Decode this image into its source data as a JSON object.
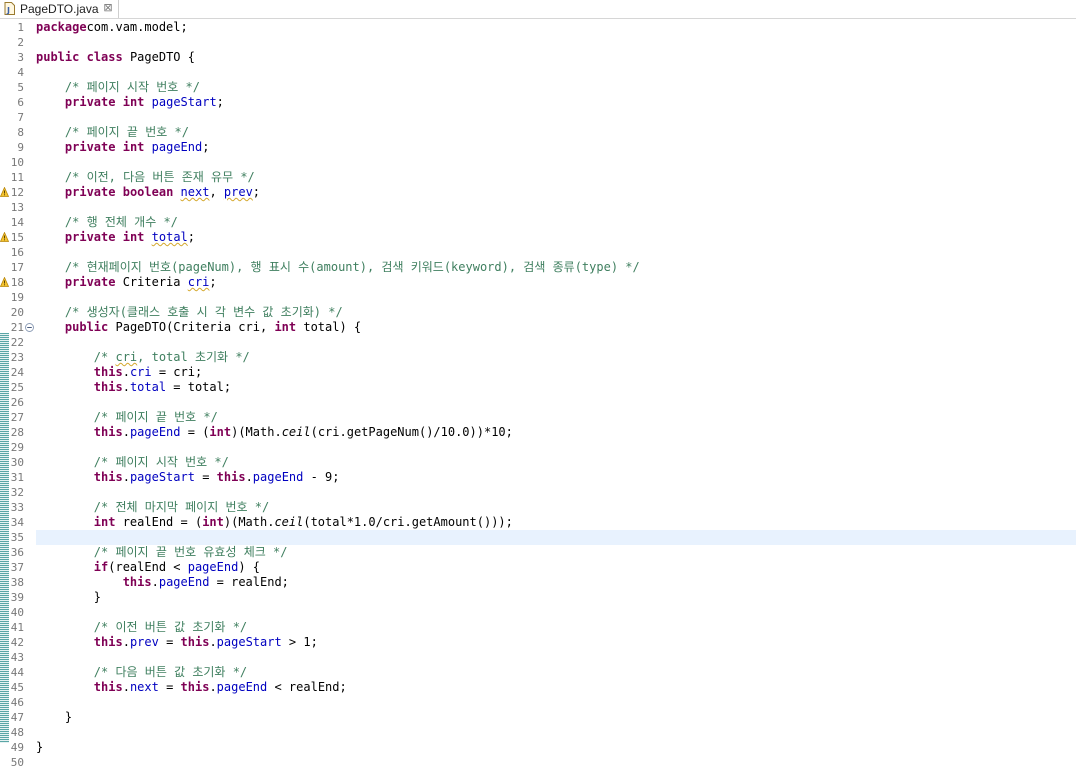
{
  "tab": {
    "file_icon": "java-file-icon",
    "label": "PageDTO.java",
    "close_icon": "close-icon",
    "close_glyph": "⊠"
  },
  "editor": {
    "current_line": 35,
    "lines": [
      {
        "n": "1",
        "t": [
          [
            "kw",
            "package"
          ],
          [
            "",
            "com.vam.model;"
          ]
        ]
      },
      {
        "n": "2",
        "t": []
      },
      {
        "n": "3",
        "t": [
          [
            "kw",
            "public"
          ],
          [
            "",
            " "
          ],
          [
            "kw",
            "class"
          ],
          [
            "",
            " PageDTO {"
          ]
        ]
      },
      {
        "n": "4",
        "t": []
      },
      {
        "n": "5",
        "t": [
          [
            "",
            "    "
          ],
          [
            "cm",
            "/* 페이지 시작 번호 */"
          ]
        ]
      },
      {
        "n": "6",
        "t": [
          [
            "",
            "    "
          ],
          [
            "kw",
            "private"
          ],
          [
            "",
            " "
          ],
          [
            "kw",
            "int"
          ],
          [
            "",
            " "
          ],
          [
            "fd",
            "pageStart"
          ],
          [
            "",
            ";"
          ]
        ]
      },
      {
        "n": "7",
        "t": []
      },
      {
        "n": "8",
        "t": [
          [
            "",
            "    "
          ],
          [
            "cm",
            "/* 페이지 끝 번호 */"
          ]
        ]
      },
      {
        "n": "9",
        "t": [
          [
            "",
            "    "
          ],
          [
            "kw",
            "private"
          ],
          [
            "",
            " "
          ],
          [
            "kw",
            "int"
          ],
          [
            "",
            " "
          ],
          [
            "fd",
            "pageEnd"
          ],
          [
            "",
            ";"
          ]
        ]
      },
      {
        "n": "10",
        "t": []
      },
      {
        "n": "11",
        "t": [
          [
            "",
            "    "
          ],
          [
            "cm",
            "/* 이전, 다음 버튼 존재 유무 */"
          ]
        ]
      },
      {
        "n": "12",
        "w": true,
        "t": [
          [
            "",
            "    "
          ],
          [
            "kw",
            "private"
          ],
          [
            "",
            " "
          ],
          [
            "kw",
            "boolean"
          ],
          [
            "",
            " "
          ],
          [
            "fd wv",
            "next"
          ],
          [
            "",
            ", "
          ],
          [
            "fd wv",
            "prev"
          ],
          [
            "",
            ";"
          ]
        ]
      },
      {
        "n": "13",
        "t": []
      },
      {
        "n": "14",
        "t": [
          [
            "",
            "    "
          ],
          [
            "cm",
            "/* 행 전체 개수 */"
          ]
        ]
      },
      {
        "n": "15",
        "w": true,
        "t": [
          [
            "",
            "    "
          ],
          [
            "kw",
            "private"
          ],
          [
            "",
            " "
          ],
          [
            "kw",
            "int"
          ],
          [
            "",
            " "
          ],
          [
            "fd wv",
            "total"
          ],
          [
            "",
            ";"
          ]
        ]
      },
      {
        "n": "16",
        "t": []
      },
      {
        "n": "17",
        "t": [
          [
            "",
            "    "
          ],
          [
            "cm",
            "/* 현재페이지 번호(pageNum), 행 표시 수(amount), 검색 키워드(keyword), 검색 종류(type) */"
          ]
        ]
      },
      {
        "n": "18",
        "w": true,
        "t": [
          [
            "",
            "    "
          ],
          [
            "kw",
            "private"
          ],
          [
            "",
            " Criteria "
          ],
          [
            "fd wv",
            "cri"
          ],
          [
            "",
            ";"
          ]
        ]
      },
      {
        "n": "19",
        "t": []
      },
      {
        "n": "20",
        "t": [
          [
            "",
            "    "
          ],
          [
            "cm",
            "/* 생성자(클래스 호출 시 각 변수 값 초기화) */"
          ]
        ]
      },
      {
        "n": "21",
        "f": true,
        "t": [
          [
            "",
            "    "
          ],
          [
            "kw",
            "public"
          ],
          [
            "",
            " PageDTO(Criteria cri, "
          ],
          [
            "kw",
            "int"
          ],
          [
            "",
            " total) {"
          ]
        ]
      },
      {
        "n": "22",
        "t": []
      },
      {
        "n": "23",
        "t": [
          [
            "",
            "        "
          ],
          [
            "cm",
            "/* "
          ],
          [
            "cm wv",
            "cri"
          ],
          [
            "cm",
            ", total 초기화 */"
          ]
        ]
      },
      {
        "n": "24",
        "t": [
          [
            "",
            "        "
          ],
          [
            "kw",
            "this"
          ],
          [
            "",
            "."
          ],
          [
            "fd",
            "cri"
          ],
          [
            "",
            " = cri;"
          ]
        ]
      },
      {
        "n": "25",
        "t": [
          [
            "",
            "        "
          ],
          [
            "kw",
            "this"
          ],
          [
            "",
            "."
          ],
          [
            "fd",
            "total"
          ],
          [
            "",
            " = total;"
          ]
        ]
      },
      {
        "n": "26",
        "t": []
      },
      {
        "n": "27",
        "t": [
          [
            "",
            "        "
          ],
          [
            "cm",
            "/* 페이지 끝 번호 */"
          ]
        ]
      },
      {
        "n": "28",
        "t": [
          [
            "",
            "        "
          ],
          [
            "kw",
            "this"
          ],
          [
            "",
            "."
          ],
          [
            "fd",
            "pageEnd"
          ],
          [
            "",
            " = ("
          ],
          [
            "kw",
            "int"
          ],
          [
            "",
            ")(Math."
          ],
          [
            "st",
            "ceil"
          ],
          [
            "",
            "(cri.getPageNum()/10.0))*10;"
          ]
        ]
      },
      {
        "n": "29",
        "t": []
      },
      {
        "n": "30",
        "t": [
          [
            "",
            "        "
          ],
          [
            "cm",
            "/* 페이지 시작 번호 */"
          ]
        ]
      },
      {
        "n": "31",
        "t": [
          [
            "",
            "        "
          ],
          [
            "kw",
            "this"
          ],
          [
            "",
            "."
          ],
          [
            "fd",
            "pageStart"
          ],
          [
            "",
            " = "
          ],
          [
            "kw",
            "this"
          ],
          [
            "",
            "."
          ],
          [
            "fd",
            "pageEnd"
          ],
          [
            "",
            " - 9;"
          ]
        ]
      },
      {
        "n": "32",
        "t": []
      },
      {
        "n": "33",
        "t": [
          [
            "",
            "        "
          ],
          [
            "cm",
            "/* 전체 마지막 페이지 번호 */"
          ]
        ]
      },
      {
        "n": "34",
        "t": [
          [
            "",
            "        "
          ],
          [
            "kw",
            "int"
          ],
          [
            "",
            " realEnd = ("
          ],
          [
            "kw",
            "int"
          ],
          [
            "",
            ")(Math."
          ],
          [
            "st",
            "ceil"
          ],
          [
            "",
            "(total*1.0/cri.getAmount()));"
          ]
        ]
      },
      {
        "n": "35",
        "t": []
      },
      {
        "n": "36",
        "t": [
          [
            "",
            "        "
          ],
          [
            "cm",
            "/* 페이지 끝 번호 유효성 체크 */"
          ]
        ]
      },
      {
        "n": "37",
        "t": [
          [
            "",
            "        "
          ],
          [
            "kw",
            "if"
          ],
          [
            "",
            "(realEnd < "
          ],
          [
            "fd",
            "pageEnd"
          ],
          [
            "",
            ") {"
          ]
        ]
      },
      {
        "n": "38",
        "t": [
          [
            "",
            "            "
          ],
          [
            "kw",
            "this"
          ],
          [
            "",
            "."
          ],
          [
            "fd",
            "pageEnd"
          ],
          [
            "",
            " = realEnd;"
          ]
        ]
      },
      {
        "n": "39",
        "t": [
          [
            "",
            "        }"
          ]
        ]
      },
      {
        "n": "40",
        "t": []
      },
      {
        "n": "41",
        "t": [
          [
            "",
            "        "
          ],
          [
            "cm",
            "/* 이전 버튼 값 초기화 */"
          ]
        ]
      },
      {
        "n": "42",
        "t": [
          [
            "",
            "        "
          ],
          [
            "kw",
            "this"
          ],
          [
            "",
            "."
          ],
          [
            "fd",
            "prev"
          ],
          [
            "",
            " = "
          ],
          [
            "kw",
            "this"
          ],
          [
            "",
            "."
          ],
          [
            "fd",
            "pageStart"
          ],
          [
            "",
            " > 1;"
          ]
        ]
      },
      {
        "n": "43",
        "t": []
      },
      {
        "n": "44",
        "t": [
          [
            "",
            "        "
          ],
          [
            "cm",
            "/* 다음 버튼 값 초기화 */"
          ]
        ]
      },
      {
        "n": "45",
        "t": [
          [
            "",
            "        "
          ],
          [
            "kw",
            "this"
          ],
          [
            "",
            "."
          ],
          [
            "fd",
            "next"
          ],
          [
            "",
            " = "
          ],
          [
            "kw",
            "this"
          ],
          [
            "",
            "."
          ],
          [
            "fd",
            "pageEnd"
          ],
          [
            "",
            " < realEnd;"
          ]
        ]
      },
      {
        "n": "46",
        "t": []
      },
      {
        "n": "47",
        "t": [
          [
            "",
            "    }"
          ]
        ]
      },
      {
        "n": "48",
        "t": []
      },
      {
        "n": "49",
        "t": [
          [
            "",
            "}"
          ]
        ]
      },
      {
        "n": "50",
        "t": []
      }
    ]
  }
}
